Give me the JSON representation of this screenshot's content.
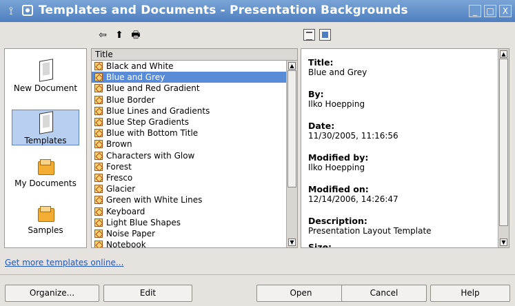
{
  "window": {
    "title": "Templates and Documents - Presentation Backgrounds",
    "menu_icon": "window-menu-icon",
    "app_icon": "app-icon",
    "controls": [
      "minimize-icon",
      "maximize-icon",
      "close-icon"
    ],
    "control_glyphs": [
      "_",
      "□",
      "X"
    ]
  },
  "toolbar": {
    "left_icons": [
      "back-icon",
      "folder-up-icon",
      "print-icon"
    ],
    "left_glyphs": [
      "⇦",
      "⬆",
      "🖶"
    ],
    "right_icons": [
      "document-properties-icon",
      "preview-icon"
    ]
  },
  "sidebar": {
    "items": [
      {
        "label": "New Document",
        "icon": "new-document-icon"
      },
      {
        "label": "Templates",
        "icon": "templates-icon"
      },
      {
        "label": "My Documents",
        "icon": "my-documents-folder-icon"
      },
      {
        "label": "Samples",
        "icon": "samples-folder-icon"
      }
    ]
  },
  "list": {
    "header": "Title",
    "items": [
      "Black and White",
      "Blue and Grey",
      "Blue and Red Gradient",
      "Blue Border",
      "Blue Lines and Gradients",
      "Blue Step Gradients",
      "Blue with Bottom Title",
      "Brown",
      "Characters with Glow",
      "Forest",
      "Fresco",
      "Glacier",
      "Green with White Lines",
      "Keyboard",
      "Light Blue Shapes",
      "Noise Paper",
      "Notebook"
    ],
    "selected": "Blue and Grey"
  },
  "details": {
    "fields": [
      {
        "label": "Title:",
        "value": "Blue and Grey"
      },
      {
        "label": "By:",
        "value": "Ilko Hoepping"
      },
      {
        "label": "Date:",
        "value": "11/30/2005, 11:16:56"
      },
      {
        "label": "Modified by:",
        "value": "Ilko Hoepping"
      },
      {
        "label": "Modified on:",
        "value": "12/14/2006, 14:26:47"
      },
      {
        "label": "Description:",
        "value": "Presentation Layout Template"
      },
      {
        "label": "Size:",
        "value": ""
      }
    ]
  },
  "footer": {
    "link": "Get more templates online...",
    "buttons": [
      "Organize...",
      "Edit",
      "Open",
      "Cancel",
      "Help"
    ]
  },
  "colors": {
    "titlebar": "#5f8fcb",
    "selection": "#5a8bd6",
    "link": "#2557b5"
  }
}
